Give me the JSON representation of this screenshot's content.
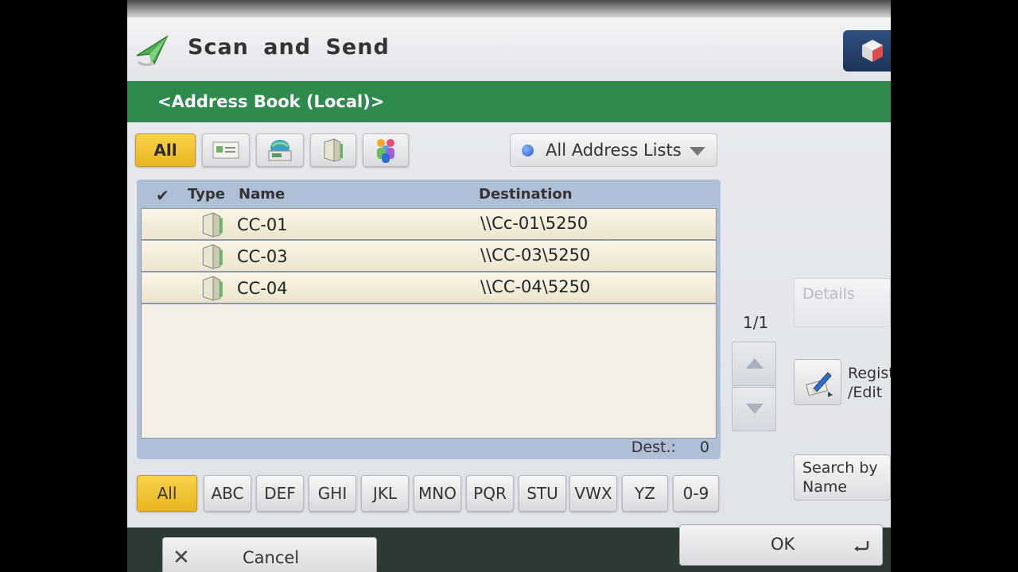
{
  "header": {
    "title": "Scan and Send",
    "icon": "send-arrow-icon",
    "corner_icon": "cube-icon"
  },
  "band": {
    "title": "<Address Book (Local)>"
  },
  "type_filters": [
    {
      "label": "All",
      "icon": "",
      "active": true
    },
    {
      "label": "",
      "icon": "email-card-icon",
      "active": false
    },
    {
      "label": "",
      "icon": "fax-machine-icon",
      "active": false
    },
    {
      "label": "",
      "icon": "file-server-icon",
      "active": false
    },
    {
      "label": "",
      "icon": "group-icon",
      "active": false
    }
  ],
  "address_list": {
    "label": "All Address Lists"
  },
  "table": {
    "headers": {
      "check": "✔",
      "type": "Type",
      "name": "Name",
      "destination": "Destination"
    },
    "rows": [
      {
        "type_icon": "file-server-icon",
        "name": "CC-01",
        "destination": "\\\\Cc-01\\5250"
      },
      {
        "type_icon": "file-server-icon",
        "name": "CC-03",
        "destination": "\\\\CC-03\\5250"
      },
      {
        "type_icon": "file-server-icon",
        "name": "CC-04",
        "destination": "\\\\CC-04\\5250"
      }
    ],
    "dest_label": "Dest.:",
    "dest_count": "0"
  },
  "alpha_filters": [
    "All",
    "ABC",
    "DEF",
    "GHI",
    "JKL",
    "MNO",
    "PQR",
    "STU",
    "VWX",
    "YZ",
    "0-9"
  ],
  "pager": {
    "page": "1/1"
  },
  "side": {
    "details": "Details",
    "register": "Regist\n/Edit",
    "search": "Search by\nName"
  },
  "bottom": {
    "cancel": "Cancel",
    "ok": "OK"
  },
  "colors": {
    "band": "#2f8a4d",
    "active": "#f2c434",
    "table_header": "#aebfd6"
  }
}
